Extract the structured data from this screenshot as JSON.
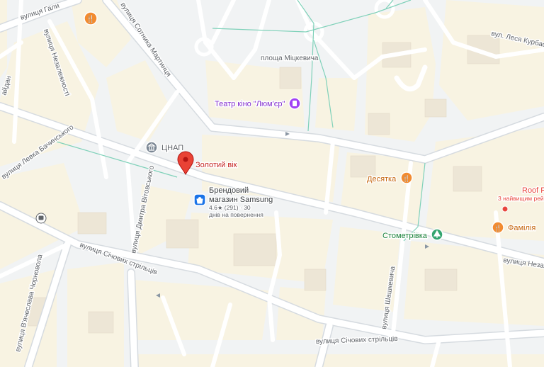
{
  "colors": {
    "background": "#f1f3f4",
    "block": "#f8f3e2",
    "building": "#ede6d6",
    "road": "#ffffff",
    "road_edge": "#d6dbe0",
    "highlight_road": "#c7d2dc",
    "tram": "#7fd1b9",
    "pin_red": "#e94235",
    "food": "#f28b30",
    "park": "#34a56f",
    "cinema": "#a142f4",
    "store": "#1a73e8",
    "edge_label": "#e8453c",
    "poi_text_purple": "#8430ce",
    "poi_text_food": "#c5650c",
    "poi_text_red": "#c5221f",
    "poi_text_green": "#188038",
    "poi_text_gray": "#5f6368"
  },
  "streets": {
    "galytska": "вулиця Гали",
    "sotnyka_martyntsia": "вулиця Сотника Мартинця",
    "nezalezhnosti_vertical": "вулиця Незалежності",
    "lesia_kurbasa": "вул. Леся Курбаса",
    "mitskevycha": "площа Міцкевича",
    "levka_bachynskoho": "вулиця Левка Бачинського",
    "dmytra_vitovskoho": "вулиця Дмитра Вітовського",
    "sichovykh_striltsiv_upper": "вулиця Січових стрільців",
    "viacheslava_chornovola": "вулиця В'ячеслава Чорновола",
    "shashkevycha": "вулиця Шашкевича",
    "sichovykh_striltsiv_lower": "вулиця Січових стрільців",
    "nezalezhnosti_edge": "вулиця Незал",
    "left_edge": "айдан"
  },
  "pois": {
    "cinema": "Театр кіно \"Люм'єр\"",
    "tsnap": "ЦНАП",
    "zolotyi_vik": "Золотий вік",
    "samsung_line1": "Брендовий",
    "samsung_line2": "магазин Samsung",
    "samsung_rating": "4.6★ (291) · 30",
    "samsung_return": "днів на повернення",
    "desiatka": "Десятка",
    "stometrivka": "Стометрівка",
    "familiia": "Фамілія",
    "roof": "Roof R",
    "roof_sub": "3 найвищим рей"
  },
  "icons": {
    "restaurant": "fork-knife-icon",
    "museum": "museum-icon",
    "cinema": "film-icon",
    "store": "shopping-bag-icon",
    "pin": "map-pin-icon",
    "park": "tree-icon",
    "bus": "bus-stop-icon"
  }
}
